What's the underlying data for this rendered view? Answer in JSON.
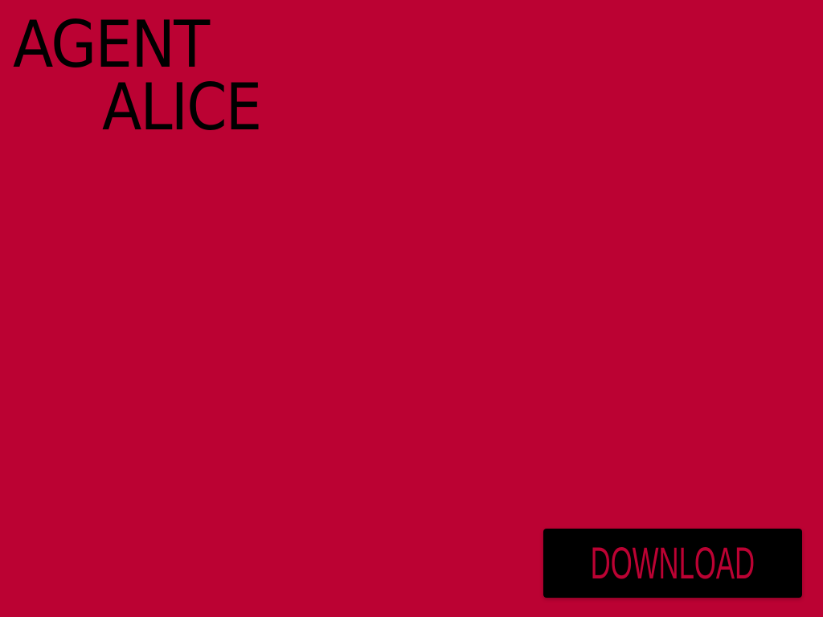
{
  "colors": {
    "background": "#bb0233",
    "logo_text": "#000000",
    "button_background": "#000000",
    "button_text": "#bb0233"
  },
  "logo": {
    "line1": "AGENT",
    "line2": "ALICE"
  },
  "actions": {
    "download_label": "DOWNLOAD"
  }
}
